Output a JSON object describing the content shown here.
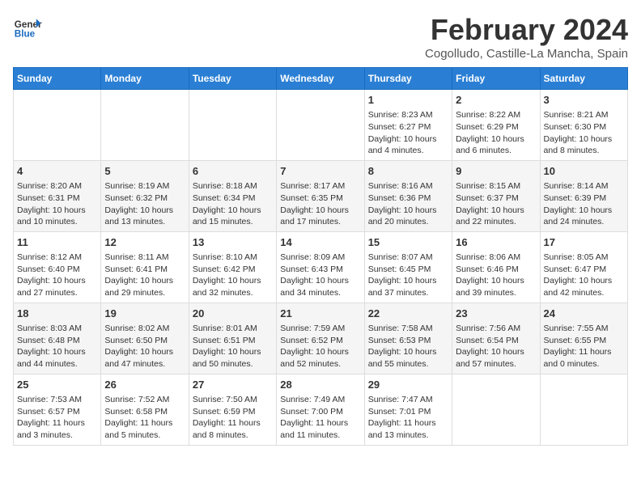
{
  "header": {
    "logo_line1": "General",
    "logo_line2": "Blue",
    "title": "February 2024",
    "subtitle": "Cogolludo, Castille-La Mancha, Spain"
  },
  "days_of_week": [
    "Sunday",
    "Monday",
    "Tuesday",
    "Wednesday",
    "Thursday",
    "Friday",
    "Saturday"
  ],
  "weeks": [
    {
      "cells": [
        {
          "day": null,
          "info": null
        },
        {
          "day": null,
          "info": null
        },
        {
          "day": null,
          "info": null
        },
        {
          "day": null,
          "info": null
        },
        {
          "day": "1",
          "info": "Sunrise: 8:23 AM\nSunset: 6:27 PM\nDaylight: 10 hours\nand 4 minutes."
        },
        {
          "day": "2",
          "info": "Sunrise: 8:22 AM\nSunset: 6:29 PM\nDaylight: 10 hours\nand 6 minutes."
        },
        {
          "day": "3",
          "info": "Sunrise: 8:21 AM\nSunset: 6:30 PM\nDaylight: 10 hours\nand 8 minutes."
        }
      ]
    },
    {
      "cells": [
        {
          "day": "4",
          "info": "Sunrise: 8:20 AM\nSunset: 6:31 PM\nDaylight: 10 hours\nand 10 minutes."
        },
        {
          "day": "5",
          "info": "Sunrise: 8:19 AM\nSunset: 6:32 PM\nDaylight: 10 hours\nand 13 minutes."
        },
        {
          "day": "6",
          "info": "Sunrise: 8:18 AM\nSunset: 6:34 PM\nDaylight: 10 hours\nand 15 minutes."
        },
        {
          "day": "7",
          "info": "Sunrise: 8:17 AM\nSunset: 6:35 PM\nDaylight: 10 hours\nand 17 minutes."
        },
        {
          "day": "8",
          "info": "Sunrise: 8:16 AM\nSunset: 6:36 PM\nDaylight: 10 hours\nand 20 minutes."
        },
        {
          "day": "9",
          "info": "Sunrise: 8:15 AM\nSunset: 6:37 PM\nDaylight: 10 hours\nand 22 minutes."
        },
        {
          "day": "10",
          "info": "Sunrise: 8:14 AM\nSunset: 6:39 PM\nDaylight: 10 hours\nand 24 minutes."
        }
      ]
    },
    {
      "cells": [
        {
          "day": "11",
          "info": "Sunrise: 8:12 AM\nSunset: 6:40 PM\nDaylight: 10 hours\nand 27 minutes."
        },
        {
          "day": "12",
          "info": "Sunrise: 8:11 AM\nSunset: 6:41 PM\nDaylight: 10 hours\nand 29 minutes."
        },
        {
          "day": "13",
          "info": "Sunrise: 8:10 AM\nSunset: 6:42 PM\nDaylight: 10 hours\nand 32 minutes."
        },
        {
          "day": "14",
          "info": "Sunrise: 8:09 AM\nSunset: 6:43 PM\nDaylight: 10 hours\nand 34 minutes."
        },
        {
          "day": "15",
          "info": "Sunrise: 8:07 AM\nSunset: 6:45 PM\nDaylight: 10 hours\nand 37 minutes."
        },
        {
          "day": "16",
          "info": "Sunrise: 8:06 AM\nSunset: 6:46 PM\nDaylight: 10 hours\nand 39 minutes."
        },
        {
          "day": "17",
          "info": "Sunrise: 8:05 AM\nSunset: 6:47 PM\nDaylight: 10 hours\nand 42 minutes."
        }
      ]
    },
    {
      "cells": [
        {
          "day": "18",
          "info": "Sunrise: 8:03 AM\nSunset: 6:48 PM\nDaylight: 10 hours\nand 44 minutes."
        },
        {
          "day": "19",
          "info": "Sunrise: 8:02 AM\nSunset: 6:50 PM\nDaylight: 10 hours\nand 47 minutes."
        },
        {
          "day": "20",
          "info": "Sunrise: 8:01 AM\nSunset: 6:51 PM\nDaylight: 10 hours\nand 50 minutes."
        },
        {
          "day": "21",
          "info": "Sunrise: 7:59 AM\nSunset: 6:52 PM\nDaylight: 10 hours\nand 52 minutes."
        },
        {
          "day": "22",
          "info": "Sunrise: 7:58 AM\nSunset: 6:53 PM\nDaylight: 10 hours\nand 55 minutes."
        },
        {
          "day": "23",
          "info": "Sunrise: 7:56 AM\nSunset: 6:54 PM\nDaylight: 10 hours\nand 57 minutes."
        },
        {
          "day": "24",
          "info": "Sunrise: 7:55 AM\nSunset: 6:55 PM\nDaylight: 11 hours\nand 0 minutes."
        }
      ]
    },
    {
      "cells": [
        {
          "day": "25",
          "info": "Sunrise: 7:53 AM\nSunset: 6:57 PM\nDaylight: 11 hours\nand 3 minutes."
        },
        {
          "day": "26",
          "info": "Sunrise: 7:52 AM\nSunset: 6:58 PM\nDaylight: 11 hours\nand 5 minutes."
        },
        {
          "day": "27",
          "info": "Sunrise: 7:50 AM\nSunset: 6:59 PM\nDaylight: 11 hours\nand 8 minutes."
        },
        {
          "day": "28",
          "info": "Sunrise: 7:49 AM\nSunset: 7:00 PM\nDaylight: 11 hours\nand 11 minutes."
        },
        {
          "day": "29",
          "info": "Sunrise: 7:47 AM\nSunset: 7:01 PM\nDaylight: 11 hours\nand 13 minutes."
        },
        {
          "day": null,
          "info": null
        },
        {
          "day": null,
          "info": null
        }
      ]
    }
  ]
}
